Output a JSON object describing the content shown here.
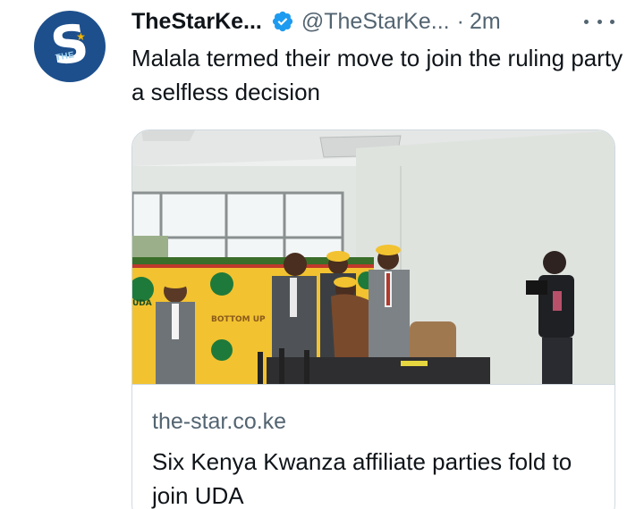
{
  "author": {
    "display_name": "TheStarKe...",
    "handle": "@TheStarKe...",
    "separator": "·",
    "time": "2m",
    "verified": true,
    "avatar_letter": "S",
    "avatar_small_text": "THE"
  },
  "tweet": {
    "text": "Malala termed their move to join the ruling party a selfless decision"
  },
  "card": {
    "banner_text_1": "UDA",
    "banner_text_2": "BOTTOM UP",
    "domain": "the-star.co.ke",
    "title": "Six Kenya Kwanza affiliate parties fold to join UDA"
  },
  "colors": {
    "verified_blue": "#1d9bf0",
    "uda_yellow": "#f2c230",
    "uda_green": "#1e7a3a",
    "muted_text": "#536471"
  },
  "icons": {
    "verified": "verified-badge-icon",
    "more": "more-options-icon"
  }
}
